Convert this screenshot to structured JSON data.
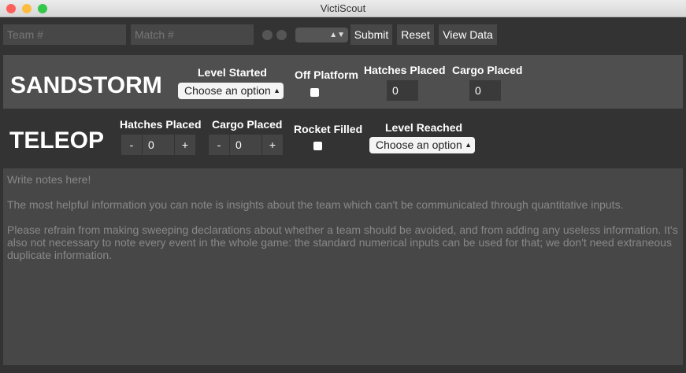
{
  "window": {
    "title": "VictiScout"
  },
  "toolbar": {
    "team_placeholder": "Team #",
    "match_placeholder": "Match #",
    "select_value": "",
    "submit": "Submit",
    "reset": "Reset",
    "view_data": "View Data"
  },
  "sandstorm": {
    "title": "SANDSTORM",
    "level_started_label": "Level Started",
    "level_started_value": "Choose an option",
    "off_platform_label": "Off Platform",
    "hatches_label": "Hatches Placed",
    "hatches_value": "0",
    "cargo_label": "Cargo Placed",
    "cargo_value": "0"
  },
  "teleop": {
    "title": "TELEOP",
    "hatches_label": "Hatches Placed",
    "hatches_value": "0",
    "cargo_label": "Cargo Placed",
    "cargo_value": "0",
    "minus": "-",
    "plus": "+",
    "rocket_label": "Rocket Filled",
    "level_reached_label": "Level Reached",
    "level_reached_value": "Choose an option"
  },
  "notes": {
    "placeholder": "Write notes here!\n\nThe most helpful information you can note is insights about the team which can't be communicated through quantitative inputs.\n\nPlease refrain from making sweeping declarations about whether a team should be avoided, and from adding any useless information. It's also not necessary to note every event in the whole game: the standard numerical inputs can be used for that; we don't need extraneous duplicate information."
  }
}
